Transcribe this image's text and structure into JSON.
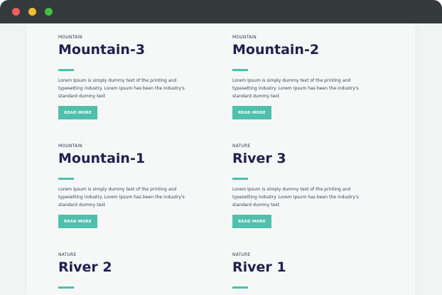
{
  "window": {
    "controls": [
      "close",
      "minimize",
      "maximize"
    ],
    "colors": {
      "titlebar": "#343a3c",
      "close": "#ed5f5a",
      "minimize": "#f5bd2e",
      "maximize": "#3fbf3f"
    }
  },
  "theme": {
    "accent": "#4ec0ad",
    "title_color": "#241d4e",
    "text_color": "#3d3a55"
  },
  "cards": [
    {
      "category": "MOUNTAIN",
      "title": "Mountain-3",
      "description": "Lorem Ipsum is simply dummy text of the printing and typesetting industry. Lorem Ipsum has been the industry's standard dummy text",
      "button": "READ MORE"
    },
    {
      "category": "MOUNTAIN",
      "title": "Mountain-2",
      "description": "Lorem Ipsum is simply dummy text of the printing and typesetting industry. Lorem Ipsum has been the industry's standard dummy text",
      "button": "READ MORE"
    },
    {
      "category": "MOUNTAIN",
      "title": "Mountain-1",
      "description": "Lorem Ipsum is simply dummy text of the printing and typesetting industry. Lorem Ipsum has been the industry's standard dummy text",
      "button": "READ MORE"
    },
    {
      "category": "NATURE",
      "title": "River 3",
      "description": "Lorem Ipsum is simply dummy text of the printing and typesetting industry. Lorem Ipsum has been the industry's standard dummy text",
      "button": "READ MORE"
    },
    {
      "category": "NATURE",
      "title": "River 2"
    },
    {
      "category": "NATURE",
      "title": "River 1"
    }
  ]
}
